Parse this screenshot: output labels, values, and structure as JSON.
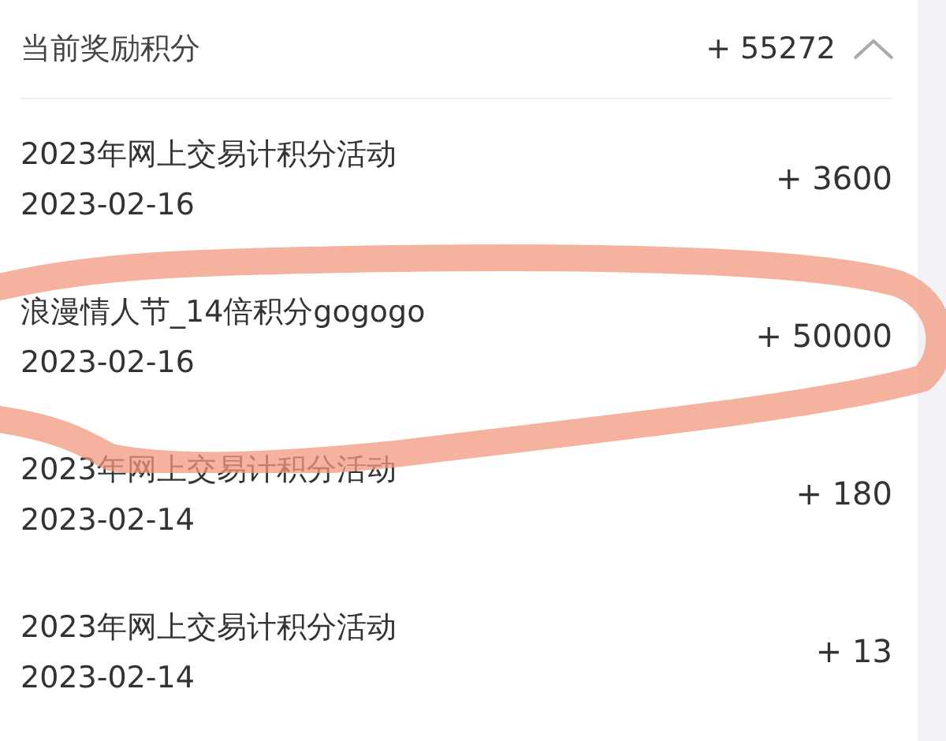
{
  "summary": {
    "label": "当前奖励积分",
    "total": "+ 55272",
    "expanded": true
  },
  "records": [
    {
      "title": "2023年网上交易计积分活动",
      "date": "2023-02-16",
      "points": "+ 3600"
    },
    {
      "title": "浪漫情人节_14倍积分gogogo",
      "date": "2023-02-16",
      "points": "+ 50000"
    },
    {
      "title": "2023年网上交易计积分活动",
      "date": "2023-02-14",
      "points": "+ 180"
    },
    {
      "title": "2023年网上交易计积分活动",
      "date": "2023-02-14",
      "points": "+ 13"
    }
  ]
}
